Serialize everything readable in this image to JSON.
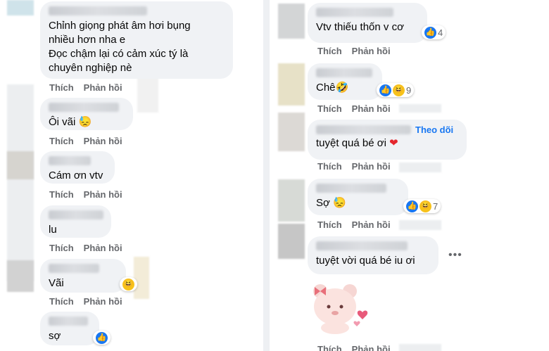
{
  "left": {
    "comments": [
      {
        "text": "Chỉnh giọng phát âm hơi bụng\nnhiều hơn nha e\nĐọc chậm lại có cảm xúc tý là\nchuyên nghiệp nè",
        "like": "Thích",
        "reply": "Phản hồi"
      },
      {
        "text": "Ôi vãi 😓",
        "like": "Thích",
        "reply": "Phản hồi"
      },
      {
        "text": "Cám ơn vtv",
        "like": "Thích",
        "reply": "Phản hồi"
      },
      {
        "text": "lu",
        "like": "Thích",
        "reply": "Phản hồi"
      },
      {
        "text": "Vãi",
        "like": "Thích",
        "reply": "Phản hồi"
      },
      {
        "text": "sợ",
        "like": "Thích",
        "reply": "Phản hồi"
      }
    ]
  },
  "right": {
    "comments": [
      {
        "text": "Vtv thiếu thốn v cơ",
        "count": "4",
        "like": "Thích",
        "reply": "Phản hồi"
      },
      {
        "text": "Chê🤣",
        "count": "9",
        "like": "Thích",
        "reply": "Phản hồi"
      },
      {
        "follow": "Theo dõi",
        "text": "tuyệt quá bé ơi",
        "like": "Thích",
        "reply": "Phản hồi"
      },
      {
        "text": "Sợ 😓",
        "count": "7",
        "like": "Thích",
        "reply": "Phản hồi"
      },
      {
        "text": "tuyệt vời quá bé iu ơi",
        "more": "•••"
      },
      {
        "like": "Thích",
        "reply": "Phản hồi"
      }
    ]
  },
  "colors": {
    "bubble": "#f0f2f5",
    "action": "#65676b",
    "accent": "#1877f2",
    "like": "#1877f2",
    "haha": "#f7c21b",
    "heart": "#e4262d"
  },
  "icons": [
    "like-icon",
    "haha-icon",
    "heart-icon",
    "sad-icon",
    "more-icon",
    "bear-sticker"
  ]
}
